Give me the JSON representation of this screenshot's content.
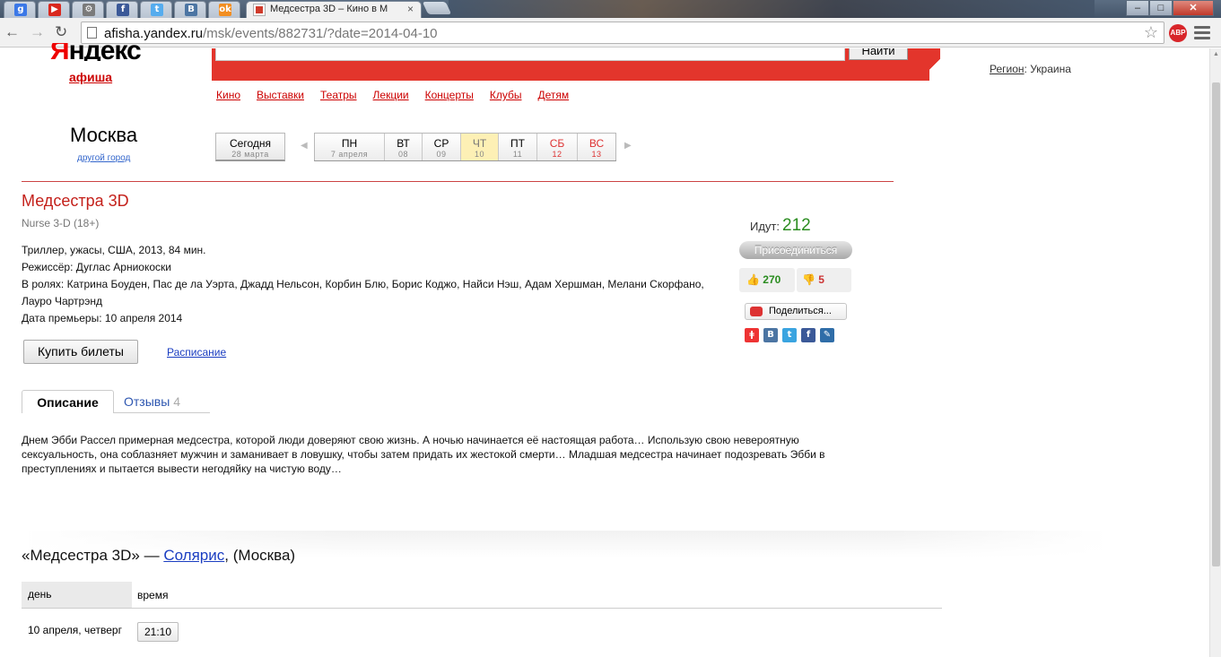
{
  "browser": {
    "pinned_tabs": [
      {
        "icon": "google-icon",
        "glyph": "g",
        "color": "#3b78e7"
      },
      {
        "icon": "youtube-icon",
        "glyph": "▶",
        "color": "#d9281e"
      },
      {
        "icon": "chrome-settings-icon",
        "glyph": "⚙",
        "color": "#7a7a7a"
      },
      {
        "icon": "facebook-icon",
        "glyph": "f",
        "color": "#3b5998"
      },
      {
        "icon": "twitter-icon",
        "glyph": "t",
        "color": "#55acee"
      },
      {
        "icon": "vk-icon",
        "glyph": "B",
        "color": "#4c75a3"
      },
      {
        "icon": "odnoklassniki-icon",
        "glyph": "ok",
        "color": "#f28e21"
      }
    ],
    "active_tab_title": "Медсестра 3D – Кино в М",
    "active_tab_close": "×",
    "url_host": "afisha.yandex.ru",
    "url_path": "/msk/events/882731/?date=2014-04-10",
    "abp_label": "ABP"
  },
  "header": {
    "logo_ya": "Я",
    "logo_rest": "ндекс",
    "afisha": "афиша",
    "find_button": "Найти",
    "region_label": "Регион",
    "region_value": ": Украина",
    "nav": [
      "Кино",
      "Выставки",
      "Театры",
      "Лекции",
      "Концерты",
      "Клубы",
      "Детям"
    ]
  },
  "city": {
    "name": "Москва",
    "change": "другой город"
  },
  "dates": {
    "today": {
      "label": "Сегодня",
      "sub": "28 марта"
    },
    "days": [
      {
        "label": "ПН",
        "sub": "7 апреля",
        "width": 78,
        "selected": false,
        "weekend": false
      },
      {
        "label": "ВТ",
        "sub": "08",
        "width": 42,
        "selected": false,
        "weekend": false
      },
      {
        "label": "СР",
        "sub": "09",
        "width": 43,
        "selected": false,
        "weekend": false
      },
      {
        "label": "ЧТ",
        "sub": "10",
        "width": 42,
        "selected": true,
        "weekend": false
      },
      {
        "label": "ПТ",
        "sub": "11",
        "width": 43,
        "selected": false,
        "weekend": false
      },
      {
        "label": "СБ",
        "sub": "12",
        "width": 45,
        "selected": false,
        "weekend": true
      },
      {
        "label": "ВС",
        "sub": "13",
        "width": 42,
        "selected": false,
        "weekend": true
      }
    ]
  },
  "film": {
    "title": "Медсестра 3D",
    "original": "Nurse 3-D (18+)",
    "genre": "Триллер, ужасы, США, 2013, 84 мин.",
    "director": "Режиссёр: Дуглас Арниокоски",
    "cast": "В ролях: Катрина Боуден, Пас де ла Уэрта, Джадд Нельсон, Корбин Блю, Борис Коджо, Найси Нэш, Адам Хершман, Мелани Скорфано, Лауро Чартрэнд",
    "premiere": "Дата премьеры: 10 апреля 2014",
    "buy_button": "Купить билеты",
    "schedule_link": "Расписание"
  },
  "social": {
    "going_label": "Идут:",
    "going_count": "212",
    "join_button": "Присоединиться",
    "likes": "270",
    "dislikes": "5",
    "share_button": "Поделиться...",
    "share_icons": [
      {
        "icon": "yandex-ru-icon",
        "glyph": "ǂ",
        "color": "#e33"
      },
      {
        "icon": "vk-share-icon",
        "glyph": "B",
        "color": "#4c75a3"
      },
      {
        "icon": "twitter-share-icon",
        "glyph": "t",
        "color": "#3aa4e0"
      },
      {
        "icon": "facebook-share-icon",
        "glyph": "f",
        "color": "#3b5998"
      },
      {
        "icon": "livejournal-icon",
        "glyph": "✎",
        "color": "#2f6da8"
      }
    ]
  },
  "tabs": {
    "description": "Описание",
    "reviews": "Отзывы",
    "reviews_count": "4"
  },
  "description": "Днем Эбби Рассел примерная медсестра, которой люди доверяют свою жизнь. А ночью начинается её настоящая работа… Использую свою невероятную сексуальность, она соблазняет мужчин и заманивает в ловушку, чтобы затем придать их жестокой смерти… Младшая медсестра начинает подозревать Эбби в преступлениях и пытается вывести негодяйку на чистую воду…",
  "showtimes": {
    "film_quoted": "«Медсестра 3D» — ",
    "cinema": "Солярис",
    "city": ", (Москва)",
    "col_day": "день",
    "col_time": "время",
    "rows": [
      {
        "day": "10 апреля, четверг",
        "time": "21:10"
      }
    ]
  }
}
